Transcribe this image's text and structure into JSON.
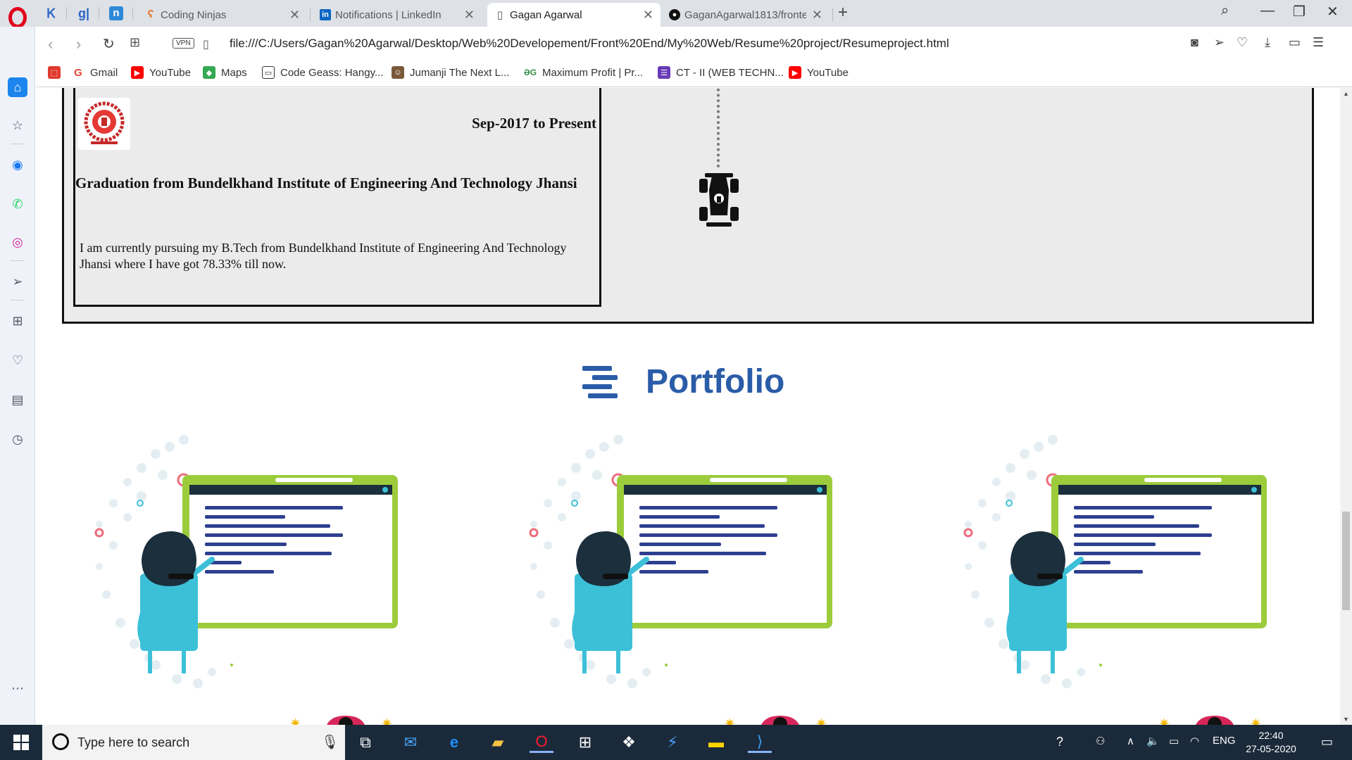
{
  "browser": {
    "tabs": [
      {
        "label": "Coding Ninjas",
        "active": false
      },
      {
        "label": "Notifications | LinkedIn",
        "active": false
      },
      {
        "label": "Gagan Agarwal",
        "active": true
      },
      {
        "label": "GaganAgarwal1813/fronte",
        "active": false
      }
    ],
    "address": {
      "vpn_label": "VPN",
      "url": "file:///C:/Users/Gagan%20Agarwal/Desktop/Web%20Developement/Front%20End/My%20Web/Resume%20project/Resumeproject.html"
    },
    "bookmarks": [
      {
        "label": "Gmail"
      },
      {
        "label": "YouTube"
      },
      {
        "label": "Maps"
      },
      {
        "label": "Code Geass: Hangy..."
      },
      {
        "label": "Jumanji The Next L..."
      },
      {
        "label": "Maximum Profit | Pr..."
      },
      {
        "label": "CT - II (WEB TECHN..."
      },
      {
        "label": "YouTube"
      }
    ]
  },
  "page": {
    "education": {
      "date": "Sep-2017 to Present",
      "title": "Graduation from Bundelkhand Institute of Engineering And Technology Jhansi",
      "description": "I am currently pursuing my B.Tech from Bundelkhand Institute of Engineering And Technology Jhansi where I have got 78.33% till now."
    },
    "portfolio": {
      "heading": "Portfolio"
    }
  },
  "taskbar": {
    "search_placeholder": "Type here to search",
    "language": "ENG",
    "time": "22:40",
    "date": "27-05-2020"
  },
  "colors": {
    "portfolio_blue": "#2a5ca8",
    "section_bg": "#ebebeb",
    "taskbar_bg": "#1b2a3a"
  }
}
